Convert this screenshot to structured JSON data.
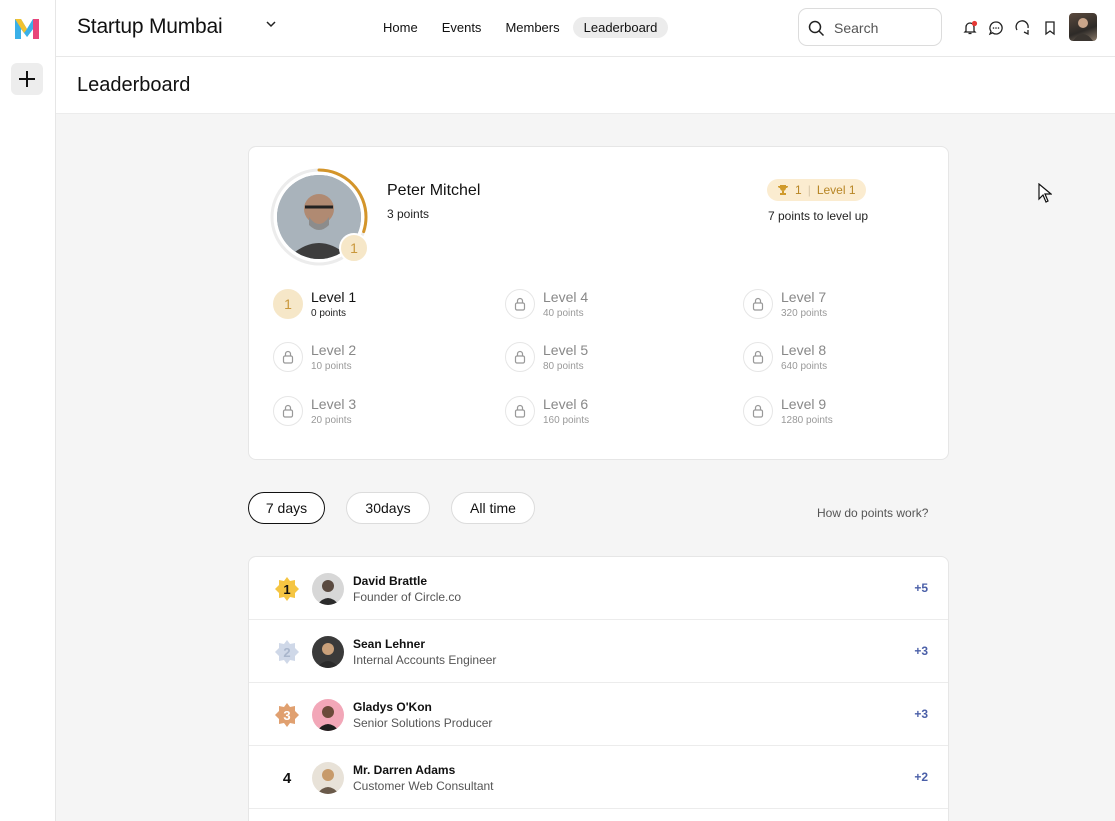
{
  "app": {
    "community_name": "Startup Mumbai",
    "logo_letter": "M"
  },
  "nav": {
    "items": [
      "Home",
      "Events",
      "Members",
      "Leaderboard"
    ],
    "active": "Leaderboard"
  },
  "search": {
    "placeholder": "Search"
  },
  "page": {
    "title": "Leaderboard"
  },
  "profile": {
    "name": "Peter Mitchel",
    "points": "3 points",
    "level_badge": "1",
    "pill_rank": "1",
    "pill_level": "Level 1",
    "to_level_up": "7 points to level up",
    "progress": 0.3
  },
  "levels": [
    {
      "num": "1",
      "name": "Level 1",
      "points": "0 points",
      "unlocked": true
    },
    {
      "num": "2",
      "name": "Level 2",
      "points": "10 points",
      "unlocked": false
    },
    {
      "num": "3",
      "name": "Level 3",
      "points": "20 points",
      "unlocked": false
    },
    {
      "num": "4",
      "name": "Level 4",
      "points": "40 points",
      "unlocked": false
    },
    {
      "num": "5",
      "name": "Level 5",
      "points": "80 points",
      "unlocked": false
    },
    {
      "num": "6",
      "name": "Level 6",
      "points": "160 points",
      "unlocked": false
    },
    {
      "num": "7",
      "name": "Level 7",
      "points": "320 points",
      "unlocked": false
    },
    {
      "num": "8",
      "name": "Level 8",
      "points": "640 points",
      "unlocked": false
    },
    {
      "num": "9",
      "name": "Level 9",
      "points": "1280 points",
      "unlocked": false
    }
  ],
  "filters": {
    "items": [
      "7 days",
      "30days",
      "All time"
    ],
    "active": "7 days",
    "help": "How do points work?"
  },
  "leaders": [
    {
      "rank": "1",
      "name": "David Brattle",
      "role": "Founder of Circle.co",
      "points": "+5",
      "medal": "gold"
    },
    {
      "rank": "2",
      "name": "Sean Lehner",
      "role": "Internal Accounts Engineer",
      "points": "+3",
      "medal": "silver"
    },
    {
      "rank": "3",
      "name": "Gladys O'Kon",
      "role": "Senior Solutions Producer",
      "points": "+3",
      "medal": "bronze"
    },
    {
      "rank": "4",
      "name": "Mr. Darren Adams",
      "role": "Customer Web Consultant",
      "points": "+2",
      "medal": "none"
    }
  ],
  "colors": {
    "gold": "#f5c542",
    "silver": "#cfd8e8",
    "bronze": "#e0a070",
    "points": "#4a5fa8",
    "level_accent": "#c9973b"
  }
}
